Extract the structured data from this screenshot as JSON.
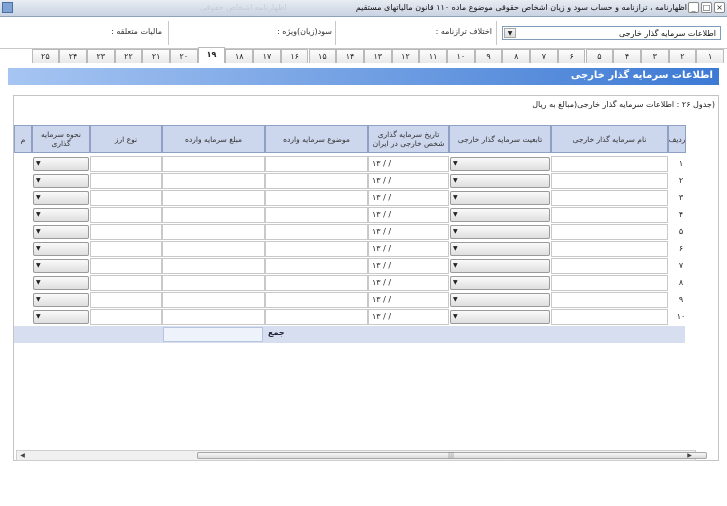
{
  "window": {
    "title": "اظهارنامه ، ترازنامه و حساب سود و زیان اشخاص حقوقی موضوع ماده ۱۱۰ قانون مالیاتهای مستقیم",
    "ghost_text": "اظهارنامه اشخاص حقوقی"
  },
  "form": {
    "dropdown_value": "اطلاعات سرمایه گذار خارجی",
    "ekhtelaf_label": "اختلاف ترازنامه :",
    "sood_label": "سود(زیان)ویژه :",
    "maliat_label": "مالیات متعلقه :"
  },
  "tabs": [
    "۱",
    "۲",
    "۳",
    "۴",
    "۵",
    "۶",
    "۷",
    "۸",
    "۹",
    "۱۰",
    "۱۱",
    "۱۲",
    "۱۳",
    "۱۴",
    "۱۵",
    "۱۶",
    "۱۷",
    "۱۸",
    "۱۹",
    "۲۰",
    "۲۱",
    "۲۲",
    "۲۳",
    "۲۴",
    "۲۵"
  ],
  "active_tab": "۱۹",
  "section": {
    "title": "اطلاعات سرمایه گذار خارجی",
    "caption": "(جدول ۲۶ : اطلاعات سرمایه گذار خارجی(مبالغ به ریال"
  },
  "table": {
    "headers": {
      "radif": "ردیف",
      "name": "نام سرمایه گذار خارجی",
      "nationality": "تابعیت سرمایه گذار خارجی",
      "date": "تاریخ سرمایه گذاری شخص خارجی در ایران",
      "subject": "موضوع سرمایه وارده",
      "amount": "مبلغ سرمایه وارده",
      "currency": "نوع ارز",
      "method": "نحوه سرمایه گذاری",
      "cut": "م"
    },
    "rows": [
      {
        "num": "۱",
        "date": "۱۳ / /"
      },
      {
        "num": "۲",
        "date": "۱۳ / /"
      },
      {
        "num": "۳",
        "date": "۱۳ / /"
      },
      {
        "num": "۴",
        "date": "۱۳ / /"
      },
      {
        "num": "۵",
        "date": "۱۳ / /"
      },
      {
        "num": "۶",
        "date": "۱۳ / /"
      },
      {
        "num": "۷",
        "date": "۱۳ / /"
      },
      {
        "num": "۸",
        "date": "۱۳ / /"
      },
      {
        "num": "۹",
        "date": "۱۳ / /"
      },
      {
        "num": "۱۰",
        "date": "۱۳ / /"
      }
    ],
    "total_label": "جمع"
  },
  "icons": {
    "dropdown_arrow": "▼",
    "scroll_left": "◀",
    "scroll_right": "▶",
    "scroll_grip": "|||"
  }
}
